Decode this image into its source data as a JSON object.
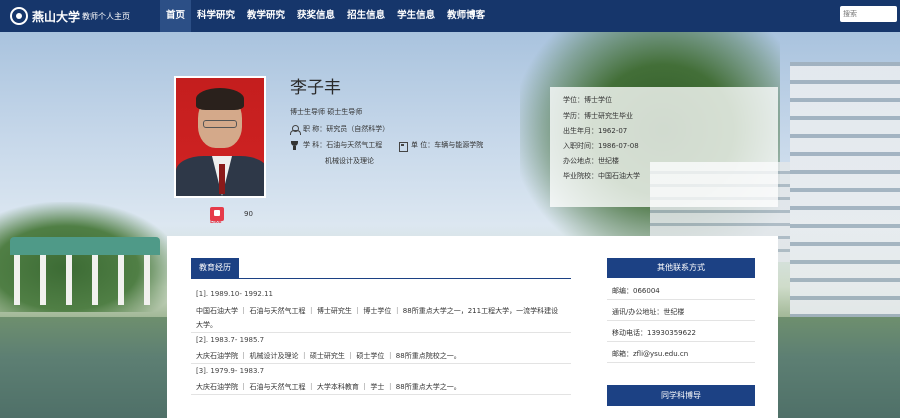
{
  "nav": {
    "logo_text": "燕山大学",
    "logo_sub": "教师个人主页",
    "items": [
      {
        "label": "首页"
      },
      {
        "label": "科学研究"
      },
      {
        "label": "教学研究"
      },
      {
        "label": "获奖信息"
      },
      {
        "label": "招生信息"
      },
      {
        "label": "学生信息"
      },
      {
        "label": "教师博客"
      }
    ],
    "search_placeholder": "搜索"
  },
  "profile": {
    "name": "李子丰",
    "tutor": "博士生导师  硕士生导师",
    "title_line": "职  称：研究员（自然科学）",
    "discipline_line": "学  科：石油与天然气工程",
    "discipline_line2": "机械设计及理论",
    "unit_line": "单  位：车辆与能源学院",
    "like_text": "Like",
    "like_count": "90"
  },
  "info": {
    "degree": "学位：博士学位",
    "education": "学历：博士研究生毕业",
    "birth": "出生年月：1962-07",
    "entry": "入职时间：1986-07-08",
    "office": "办公地点：世纪楼",
    "school": "毕业院校：中国石油大学"
  },
  "education": {
    "heading": "教育经历",
    "entries": [
      {
        "period": "[1]. 1989.10- 1992.11",
        "detail": "中国石油大学 ｜  石油与天然气工程 ｜  博士研究生 ｜  博士学位 ｜  88所重点大学之一，211工程大学，一流学科建设",
        "detail2": "大学。"
      },
      {
        "period": "[2]. 1983.7- 1985.7",
        "detail": "大庆石油学院 ｜  机械设计及理论 ｜  硕士研究生 ｜  硕士学位 ｜  88所重点院校之一。"
      },
      {
        "period": "[3]. 1979.9- 1983.7",
        "detail": "大庆石油学院 ｜  石油与天然气工程 ｜  大学本科教育 ｜  学士 ｜  88所重点大学之一。"
      }
    ]
  },
  "contact": {
    "heading": "其他联系方式",
    "postcode": "邮编：066004",
    "address": "通讯/办公地址：世纪楼",
    "phone": "移动电话：13930359622",
    "email": "邮箱：zfli@ysu.edu.cn",
    "related_heading": "同学科博导"
  }
}
